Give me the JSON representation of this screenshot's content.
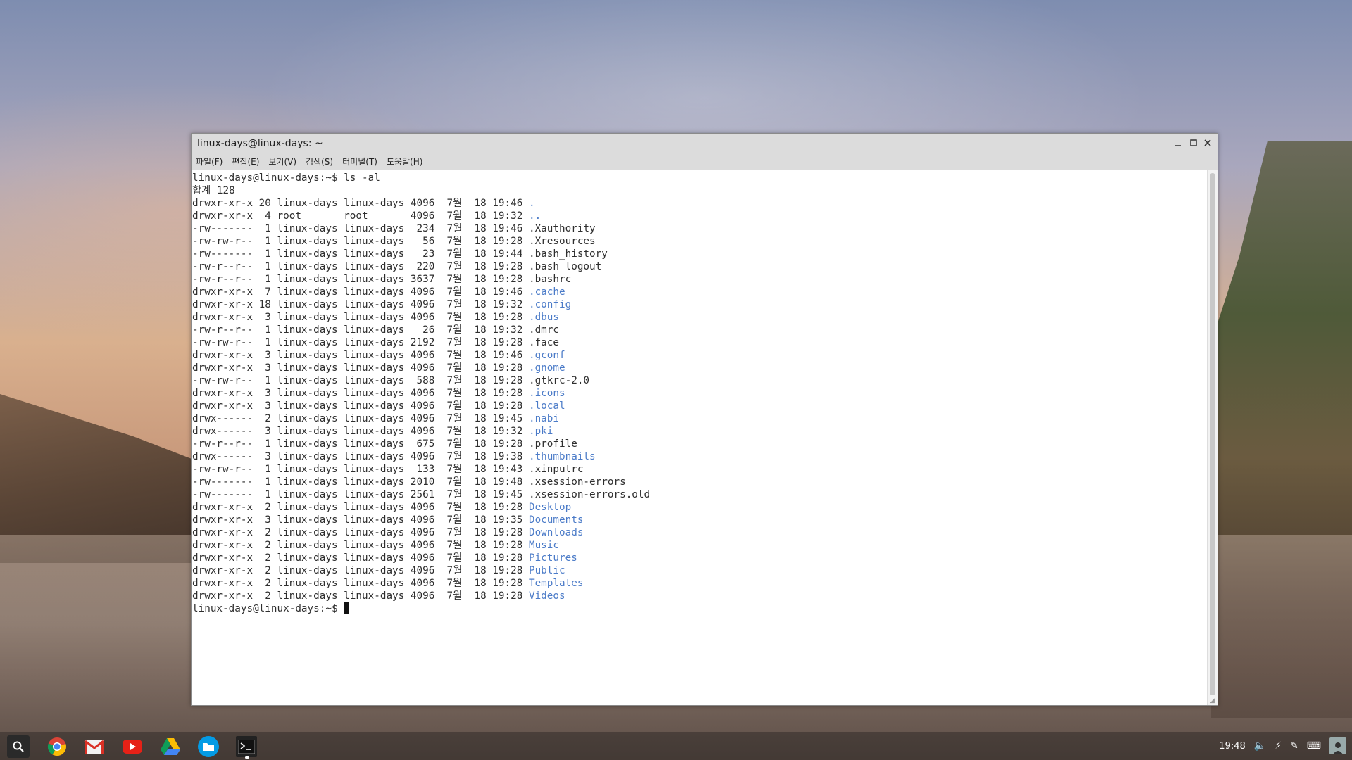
{
  "window": {
    "title": "linux-days@linux-days: ~",
    "menu": [
      {
        "label": "파일(F)"
      },
      {
        "label": "편집(E)"
      },
      {
        "label": "보기(V)"
      },
      {
        "label": "검색(S)"
      },
      {
        "label": "터미널(T)"
      },
      {
        "label": "도움말(H)"
      }
    ]
  },
  "terminal": {
    "prompt": "linux-days@linux-days:~$",
    "command": "ls -al",
    "total_line": "합계 128",
    "entries": [
      {
        "meta": "drwxr-xr-x 20 linux-days linux-days 4096  7월  18 19:46 ",
        "name": ".",
        "dir": true
      },
      {
        "meta": "drwxr-xr-x  4 root       root       4096  7월  18 19:32 ",
        "name": "..",
        "dir": true
      },
      {
        "meta": "-rw-------  1 linux-days linux-days  234  7월  18 19:46 ",
        "name": ".Xauthority",
        "dir": false
      },
      {
        "meta": "-rw-rw-r--  1 linux-days linux-days   56  7월  18 19:28 ",
        "name": ".Xresources",
        "dir": false
      },
      {
        "meta": "-rw-------  1 linux-days linux-days   23  7월  18 19:44 ",
        "name": ".bash_history",
        "dir": false
      },
      {
        "meta": "-rw-r--r--  1 linux-days linux-days  220  7월  18 19:28 ",
        "name": ".bash_logout",
        "dir": false
      },
      {
        "meta": "-rw-r--r--  1 linux-days linux-days 3637  7월  18 19:28 ",
        "name": ".bashrc",
        "dir": false
      },
      {
        "meta": "drwxr-xr-x  7 linux-days linux-days 4096  7월  18 19:46 ",
        "name": ".cache",
        "dir": true
      },
      {
        "meta": "drwxr-xr-x 18 linux-days linux-days 4096  7월  18 19:32 ",
        "name": ".config",
        "dir": true
      },
      {
        "meta": "drwxr-xr-x  3 linux-days linux-days 4096  7월  18 19:28 ",
        "name": ".dbus",
        "dir": true
      },
      {
        "meta": "-rw-r--r--  1 linux-days linux-days   26  7월  18 19:32 ",
        "name": ".dmrc",
        "dir": false
      },
      {
        "meta": "-rw-rw-r--  1 linux-days linux-days 2192  7월  18 19:28 ",
        "name": ".face",
        "dir": false
      },
      {
        "meta": "drwxr-xr-x  3 linux-days linux-days 4096  7월  18 19:46 ",
        "name": ".gconf",
        "dir": true
      },
      {
        "meta": "drwxr-xr-x  3 linux-days linux-days 4096  7월  18 19:28 ",
        "name": ".gnome",
        "dir": true
      },
      {
        "meta": "-rw-rw-r--  1 linux-days linux-days  588  7월  18 19:28 ",
        "name": ".gtkrc-2.0",
        "dir": false
      },
      {
        "meta": "drwxr-xr-x  3 linux-days linux-days 4096  7월  18 19:28 ",
        "name": ".icons",
        "dir": true
      },
      {
        "meta": "drwxr-xr-x  3 linux-days linux-days 4096  7월  18 19:28 ",
        "name": ".local",
        "dir": true
      },
      {
        "meta": "drwx------  2 linux-days linux-days 4096  7월  18 19:45 ",
        "name": ".nabi",
        "dir": true
      },
      {
        "meta": "drwx------  3 linux-days linux-days 4096  7월  18 19:32 ",
        "name": ".pki",
        "dir": true
      },
      {
        "meta": "-rw-r--r--  1 linux-days linux-days  675  7월  18 19:28 ",
        "name": ".profile",
        "dir": false
      },
      {
        "meta": "drwx------  3 linux-days linux-days 4096  7월  18 19:38 ",
        "name": ".thumbnails",
        "dir": true
      },
      {
        "meta": "-rw-rw-r--  1 linux-days linux-days  133  7월  18 19:43 ",
        "name": ".xinputrc",
        "dir": false
      },
      {
        "meta": "-rw-------  1 linux-days linux-days 2010  7월  18 19:48 ",
        "name": ".xsession-errors",
        "dir": false
      },
      {
        "meta": "-rw-------  1 linux-days linux-days 2561  7월  18 19:45 ",
        "name": ".xsession-errors.old",
        "dir": false
      },
      {
        "meta": "drwxr-xr-x  2 linux-days linux-days 4096  7월  18 19:28 ",
        "name": "Desktop",
        "dir": true
      },
      {
        "meta": "drwxr-xr-x  3 linux-days linux-days 4096  7월  18 19:35 ",
        "name": "Documents",
        "dir": true
      },
      {
        "meta": "drwxr-xr-x  2 linux-days linux-days 4096  7월  18 19:28 ",
        "name": "Downloads",
        "dir": true
      },
      {
        "meta": "drwxr-xr-x  2 linux-days linux-days 4096  7월  18 19:28 ",
        "name": "Music",
        "dir": true
      },
      {
        "meta": "drwxr-xr-x  2 linux-days linux-days 4096  7월  18 19:28 ",
        "name": "Pictures",
        "dir": true
      },
      {
        "meta": "drwxr-xr-x  2 linux-days linux-days 4096  7월  18 19:28 ",
        "name": "Public",
        "dir": true
      },
      {
        "meta": "drwxr-xr-x  2 linux-days linux-days 4096  7월  18 19:28 ",
        "name": "Templates",
        "dir": true
      },
      {
        "meta": "drwxr-xr-x  2 linux-days linux-days 4096  7월  18 19:28 ",
        "name": "Videos",
        "dir": true
      }
    ],
    "dir_color": "#4b7bc8"
  },
  "shelf": {
    "apps": [
      {
        "icon": "chrome-icon"
      },
      {
        "icon": "gmail-icon"
      },
      {
        "icon": "youtube-icon"
      },
      {
        "icon": "drive-icon"
      },
      {
        "icon": "files-icon"
      },
      {
        "icon": "terminal-icon"
      }
    ],
    "clock": "19:48",
    "tray": [
      "volume-icon",
      "network-icon",
      "ime-icon",
      "keyboard-icon"
    ]
  }
}
